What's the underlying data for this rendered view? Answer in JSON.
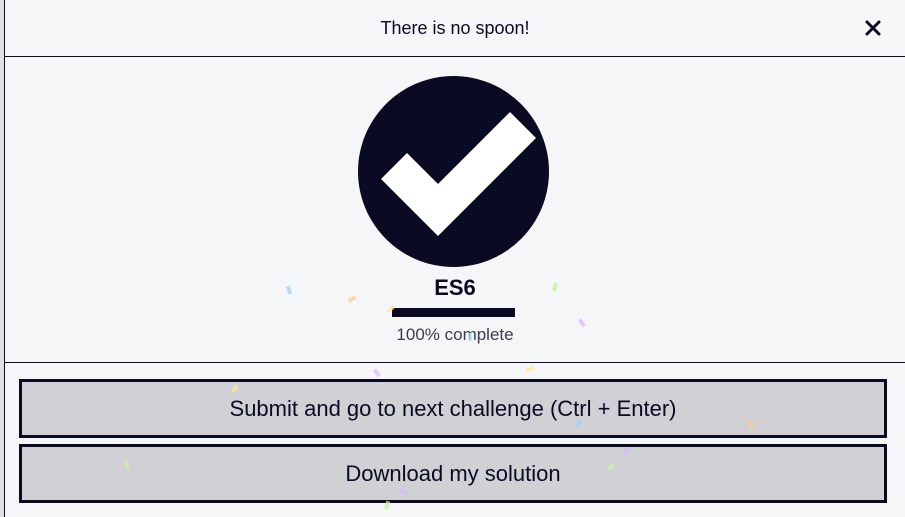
{
  "modal": {
    "title": "There is no spoon!",
    "close_icon": "close-icon"
  },
  "completion": {
    "icon": "check-mark-icon",
    "certification": "ES6",
    "progress_fraction": 1.0,
    "progress_text": "100% complete"
  },
  "actions": {
    "submit_label": "Submit and go to next challenge (Ctrl + Enter)",
    "download_label": "Download my solution"
  },
  "colors": {
    "primary": "#0a0a23",
    "modal_bg": "#f5f6f7",
    "button_bg": "#d0d0d5"
  }
}
